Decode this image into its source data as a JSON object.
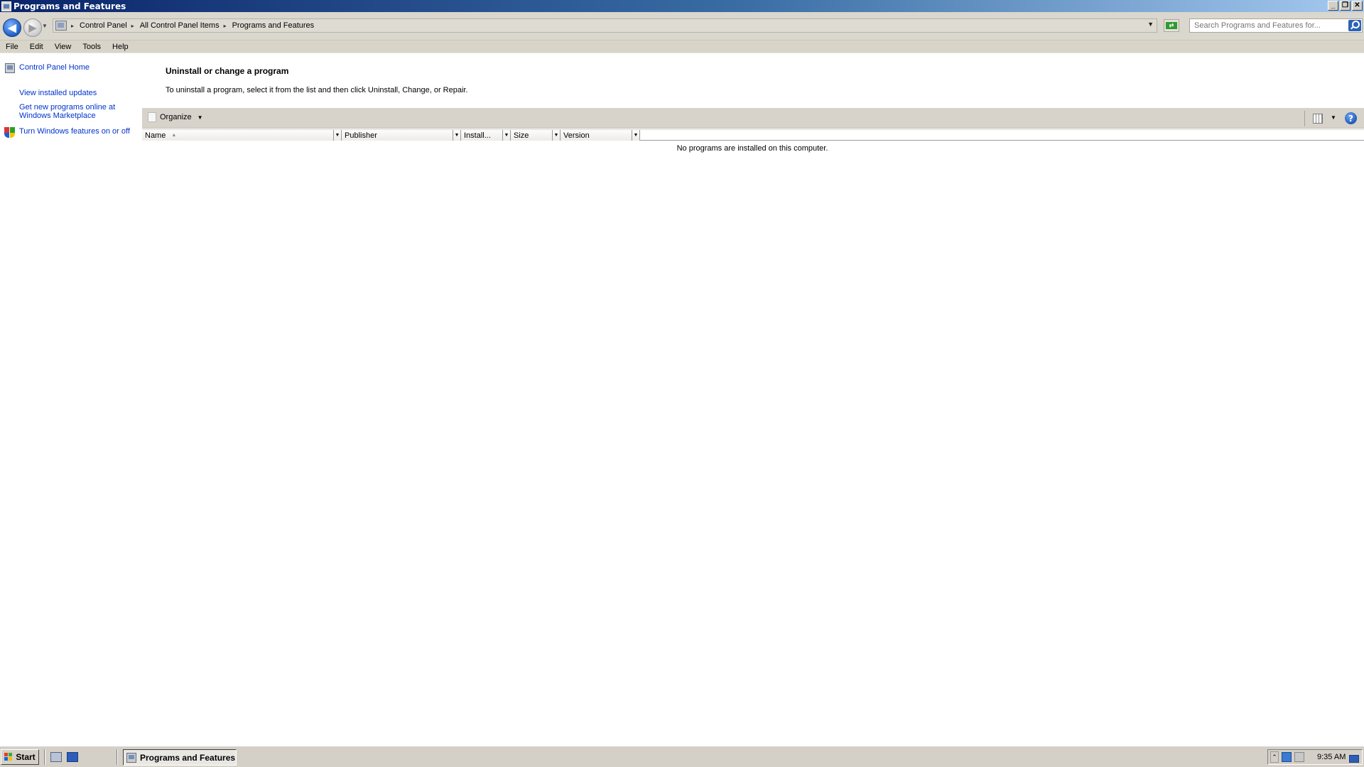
{
  "window": {
    "title": "Programs and Features",
    "controls": {
      "minimize": "_",
      "restore": "❐",
      "close": "✕"
    }
  },
  "address": {
    "crumbs": [
      "Control Panel",
      "All Control Panel Items",
      "Programs and Features"
    ],
    "search_placeholder": "Search Programs and Features for..."
  },
  "menu": [
    "File",
    "Edit",
    "View",
    "Tools",
    "Help"
  ],
  "sidebar": {
    "home": "Control Panel Home",
    "links": [
      "View installed updates",
      "Get new programs online at Windows Marketplace"
    ],
    "features": "Turn Windows features on or off"
  },
  "main": {
    "title": "Uninstall or change a program",
    "description": "To uninstall a program, select it from the list and then click Uninstall, Change, or Repair.",
    "organize": "Organize",
    "columns": [
      "Name",
      "Publisher",
      "Install...",
      "Size",
      "Version"
    ],
    "empty_message": "No programs are installed on this computer."
  },
  "taskbar": {
    "start": "Start",
    "task": "Programs and Features",
    "clock": "9:35 AM"
  },
  "colors": {
    "link": "#0033cc",
    "chrome": "#d4d0c8",
    "titlebar_start": "#0a246a",
    "titlebar_end": "#a6caf0"
  },
  "icons": [
    "program-icon",
    "back-arrow-icon",
    "forward-arrow-icon",
    "control-panel-icon",
    "refresh-icon",
    "search-icon",
    "shield-icon",
    "organize-icon",
    "views-icon",
    "help-icon",
    "windows-logo-icon"
  ]
}
